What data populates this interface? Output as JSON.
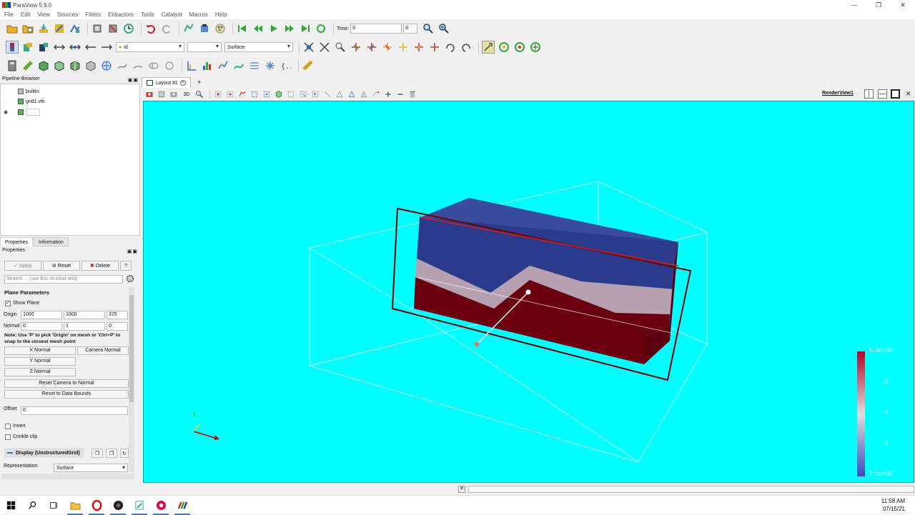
{
  "window": {
    "title": "ParaView 5.9.0"
  },
  "menu": [
    "File",
    "Edit",
    "View",
    "Sources",
    "Filters",
    "Extractors",
    "Tools",
    "Catalyst",
    "Macros",
    "Help"
  ],
  "toolbar": {
    "time_label": "Time:",
    "time_value": "0",
    "time_index": "0",
    "color_by": "id",
    "color_component": "",
    "representation": "Surface"
  },
  "pipeline": {
    "header": "Pipeline Browser",
    "items": [
      "builtin:",
      "grid1.vtk",
      ""
    ]
  },
  "panel_tabs": [
    "Properties",
    "Information"
  ],
  "properties": {
    "header": "Properties",
    "apply": "Apply",
    "reset": "Reset",
    "delete": "Delete",
    "help": "?",
    "search_placeholder": "Search ... (use Esc to clear text)",
    "section": "Plane Parameters",
    "show_plane": "Show Plane",
    "show_plane_check": "✓",
    "origin_label": "Origin",
    "origin": [
      "1000",
      "1000",
      "375"
    ],
    "normal_label": "Normal",
    "normal": [
      "0",
      "1",
      "0"
    ],
    "note": "Note: Use 'P' to pick 'Origin' on mesh or 'Ctrl+P' to snap to the closest mesh point",
    "x_normal": "X Normal",
    "camera_normal": "Camera Normal",
    "y_normal": "Y Normal",
    "z_normal": "Z Normal",
    "reset_camera": "Reset Camera to Normal",
    "reset_bounds": "Reset to Data Bounds",
    "offset_label": "Offset",
    "offset": "0",
    "invert": "Invert",
    "crinkle": "Crinkle clip",
    "display_section": "Display (UnstructuredGrid)",
    "representation_label": "Representation",
    "representation": "Surface"
  },
  "layout": {
    "tab": "Layout #1",
    "plus": "+",
    "view_name": "RenderView1",
    "mode_3d": "3D"
  },
  "colorbar": {
    "max": "6.0e+00",
    "ticks": [
      "5",
      "4",
      "3"
    ],
    "min": "2.0e+00"
  },
  "clock": {
    "time": "11:58 AM",
    "date": "07/15/21"
  },
  "colors": {
    "background": "#00ffff",
    "plane": "#6b0000",
    "top": "#3a4c9c",
    "bottom": "#6b0010"
  }
}
